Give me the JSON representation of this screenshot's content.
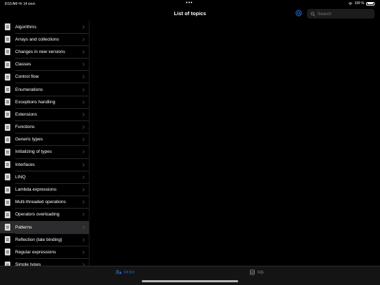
{
  "status_bar": {
    "time": "8:53 AM",
    "date": "Чт 14 сент.",
    "dots": "•••",
    "battery": "100 %"
  },
  "nav": {
    "title": "List of topics"
  },
  "search": {
    "placeholder": "Search"
  },
  "topics": [
    {
      "label": "Algorithms"
    },
    {
      "label": "Arrays and collections"
    },
    {
      "label": "Changes in new versions"
    },
    {
      "label": "Classes"
    },
    {
      "label": "Control flow"
    },
    {
      "label": "Enumerations"
    },
    {
      "label": "Exceptions handling"
    },
    {
      "label": "Extensions"
    },
    {
      "label": "Functions"
    },
    {
      "label": "Generic types"
    },
    {
      "label": "Initializing of types"
    },
    {
      "label": "Interfaces"
    },
    {
      "label": "LINQ"
    },
    {
      "label": "Lambda expressions"
    },
    {
      "label": "Multi-threaded operations"
    },
    {
      "label": "Operators overloading"
    },
    {
      "label": "Patterns"
    },
    {
      "label": "Reflection (late binding)"
    },
    {
      "label": "Regular expressions"
    },
    {
      "label": "Simple types"
    }
  ],
  "selected_topic": "Patterns",
  "tabs": [
    {
      "label": "C# 9.0",
      "icon": "csharp-icon",
      "active": true
    },
    {
      "label": "SQL",
      "icon": "database-icon",
      "active": false
    }
  ],
  "colors": {
    "accent": "#2f7cf6",
    "background": "#000000",
    "selected_row": "#2c2c2e"
  }
}
